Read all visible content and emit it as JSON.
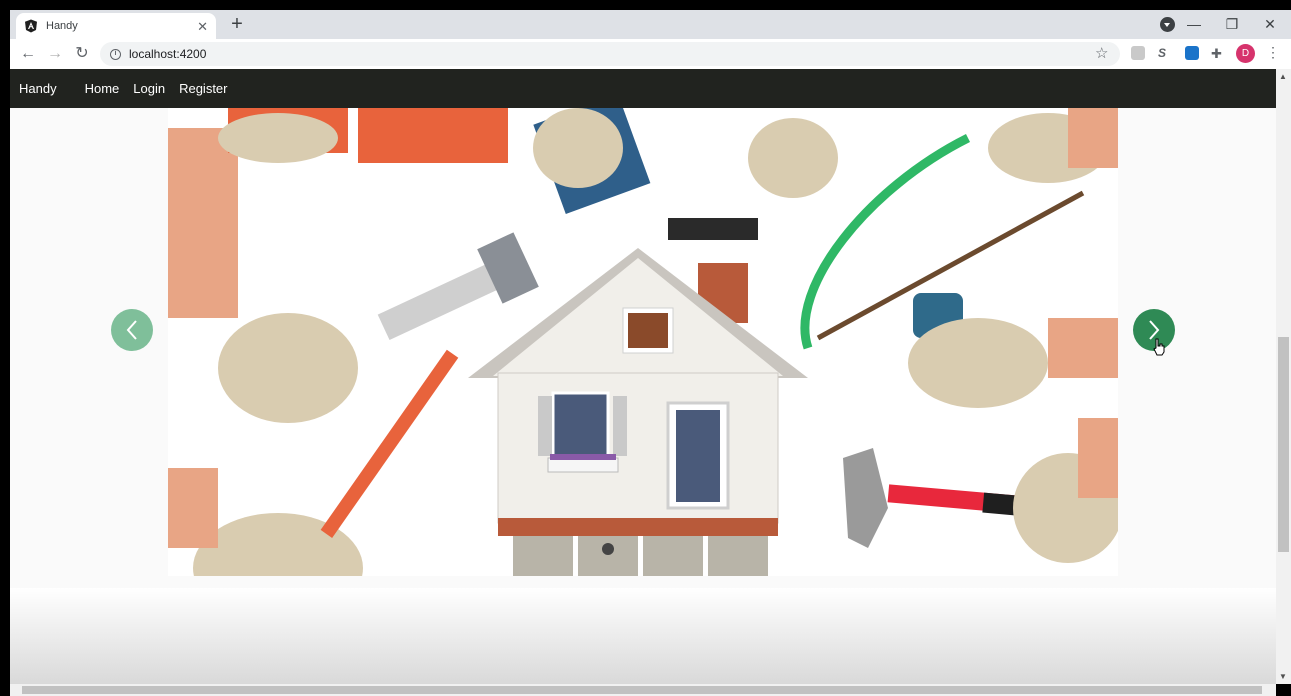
{
  "browser": {
    "tab_title": "Handy",
    "tab_close": "✕",
    "new_tab": "+",
    "url": "localhost:4200",
    "controls": {
      "minimize": "—",
      "maximize": "❐",
      "close": "✕"
    },
    "profile_initial": "D",
    "icons": [
      "angular-favicon",
      "back-icon",
      "forward-icon",
      "reload-icon",
      "info-icon",
      "star-icon",
      "extension-icon",
      "puzzle-icon",
      "kebab-icon"
    ]
  },
  "navbar": {
    "brand": "Handy",
    "links": [
      "Home",
      "Login",
      "Register"
    ]
  },
  "carousel": {
    "prev_icon": "chevron-left-icon",
    "next_icon": "chevron-right-icon",
    "colors": {
      "prev": "#7fbf9a",
      "next": "#2f8a55"
    },
    "slide_count_visible": 1,
    "image_subject": "handyman-tools-around-house"
  }
}
